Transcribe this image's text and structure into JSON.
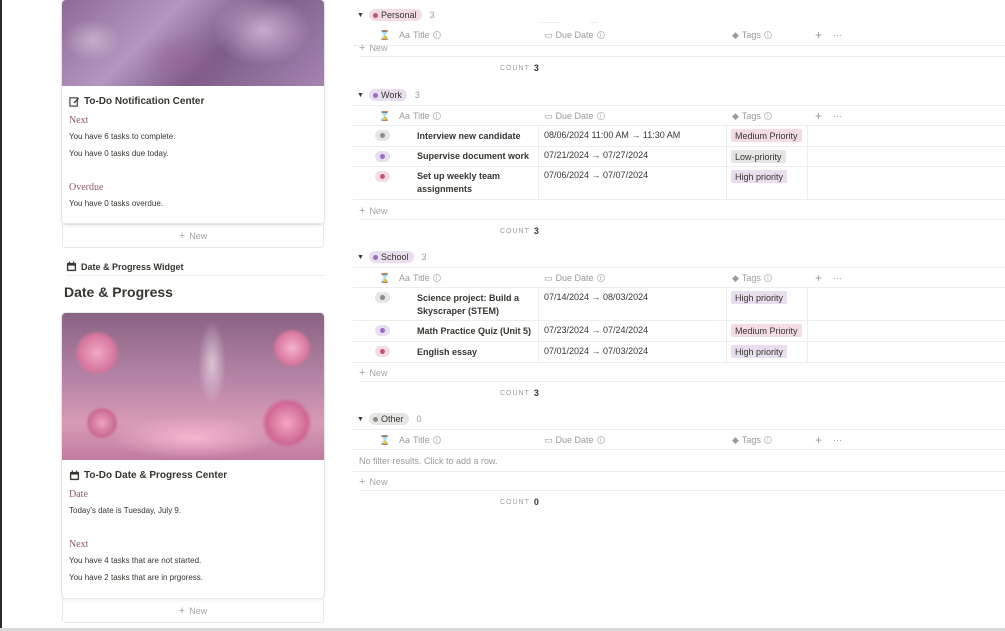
{
  "cards": [
    {
      "title": "To-Do Notification Center",
      "icon": "edit-icon",
      "sections": [
        {
          "heading": "Next",
          "lines": [
            "You have 6 tasks to complete.",
            "You have 0 tasks due today."
          ]
        },
        {
          "heading": "Overdue",
          "lines": [
            "You have 0 tasks overdue."
          ]
        }
      ]
    },
    {
      "title": "To-Do Date & Progress Center",
      "icon": "calendar-icon",
      "sections": [
        {
          "heading": "Date",
          "lines": [
            "Today's date is Tuesday, July 9."
          ]
        },
        {
          "heading": "Next",
          "lines": [
            "You have 4 tasks that are not started.",
            "You have 2 tasks that are in prgoress."
          ]
        }
      ]
    }
  ],
  "new_label": "New",
  "widget_link": "Date & Progress Widget",
  "page_heading": "Date & Progress",
  "columns": {
    "title": "Title",
    "due": "Due Date",
    "tags": "Tags",
    "title_prefix": "Aa"
  },
  "count_label": "COUNT",
  "groups": [
    {
      "name": "Personal",
      "count": "3",
      "footer_count": "3",
      "rows": []
    },
    {
      "name": "Work",
      "count": "3",
      "footer_count": "3",
      "rows": [
        {
          "title": "Interview new candidate",
          "due": "08/06/2024 11:00 AM → 11:30 AM",
          "tag": "Medium Priority",
          "status": "gray"
        },
        {
          "title": "Supervise document work",
          "due": "07/21/2024 → 07/27/2024",
          "tag": "Low-priority",
          "status": "purple"
        },
        {
          "title": "Set up weekly team assignments",
          "due": "07/06/2024 → 07/07/2024",
          "tag": "High priority",
          "status": "pink"
        }
      ]
    },
    {
      "name": "School",
      "count": "3",
      "footer_count": "3",
      "rows": [
        {
          "title": "Science project: Build a Skyscraper (STEM)",
          "due": "07/14/2024 → 08/03/2024",
          "tag": "High priority",
          "status": "gray"
        },
        {
          "title": "Math Practice Quiz (Unit 5)",
          "due": "07/23/2024 → 07/24/2024",
          "tag": "Medium Priority",
          "status": "purple"
        },
        {
          "title": "English essay",
          "due": "07/01/2024 → 07/03/2024",
          "tag": "High priority",
          "status": "pink"
        }
      ]
    },
    {
      "name": "Other",
      "count": "0",
      "footer_count": "0",
      "rows": []
    }
  ],
  "no_filter_text": "No filter results. Click to add a row.",
  "colors": {
    "pink_tag": "#f4dce6",
    "purple_tag": "#e8deee",
    "gray_tag": "#e5e5e3",
    "serif_heading": "#8d5a6a"
  }
}
